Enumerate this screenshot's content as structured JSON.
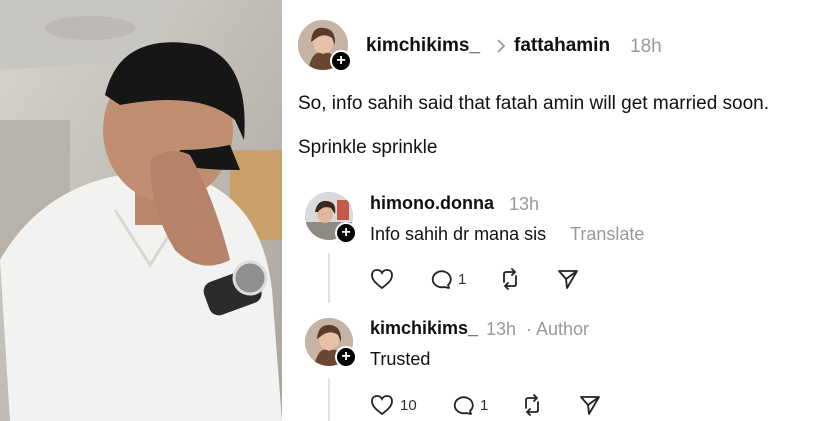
{
  "post": {
    "author": "kimchikims_",
    "reply_to": "fattahamin",
    "time": "18h",
    "lines": [
      "So, info sahih said that fatah amin will get married soon.",
      "Sprinkle sprinkle"
    ]
  },
  "replies": [
    {
      "username": "himono.donna",
      "time": "13h",
      "badge": "",
      "text": "Info sahih dr mana sis",
      "translate": "Translate",
      "likes": "",
      "comments": "1"
    },
    {
      "username": "kimchikims_",
      "time": "13h",
      "badge": "· Author",
      "text": "Trusted",
      "translate": "",
      "likes": "10",
      "comments": "1"
    }
  ],
  "icons": [
    "chevron-right-icon",
    "plus-icon",
    "heart-icon",
    "comment-icon",
    "repost-icon",
    "share-icon"
  ],
  "colors": {
    "muted": "#999999",
    "thread_line": "#e3e3e3"
  }
}
